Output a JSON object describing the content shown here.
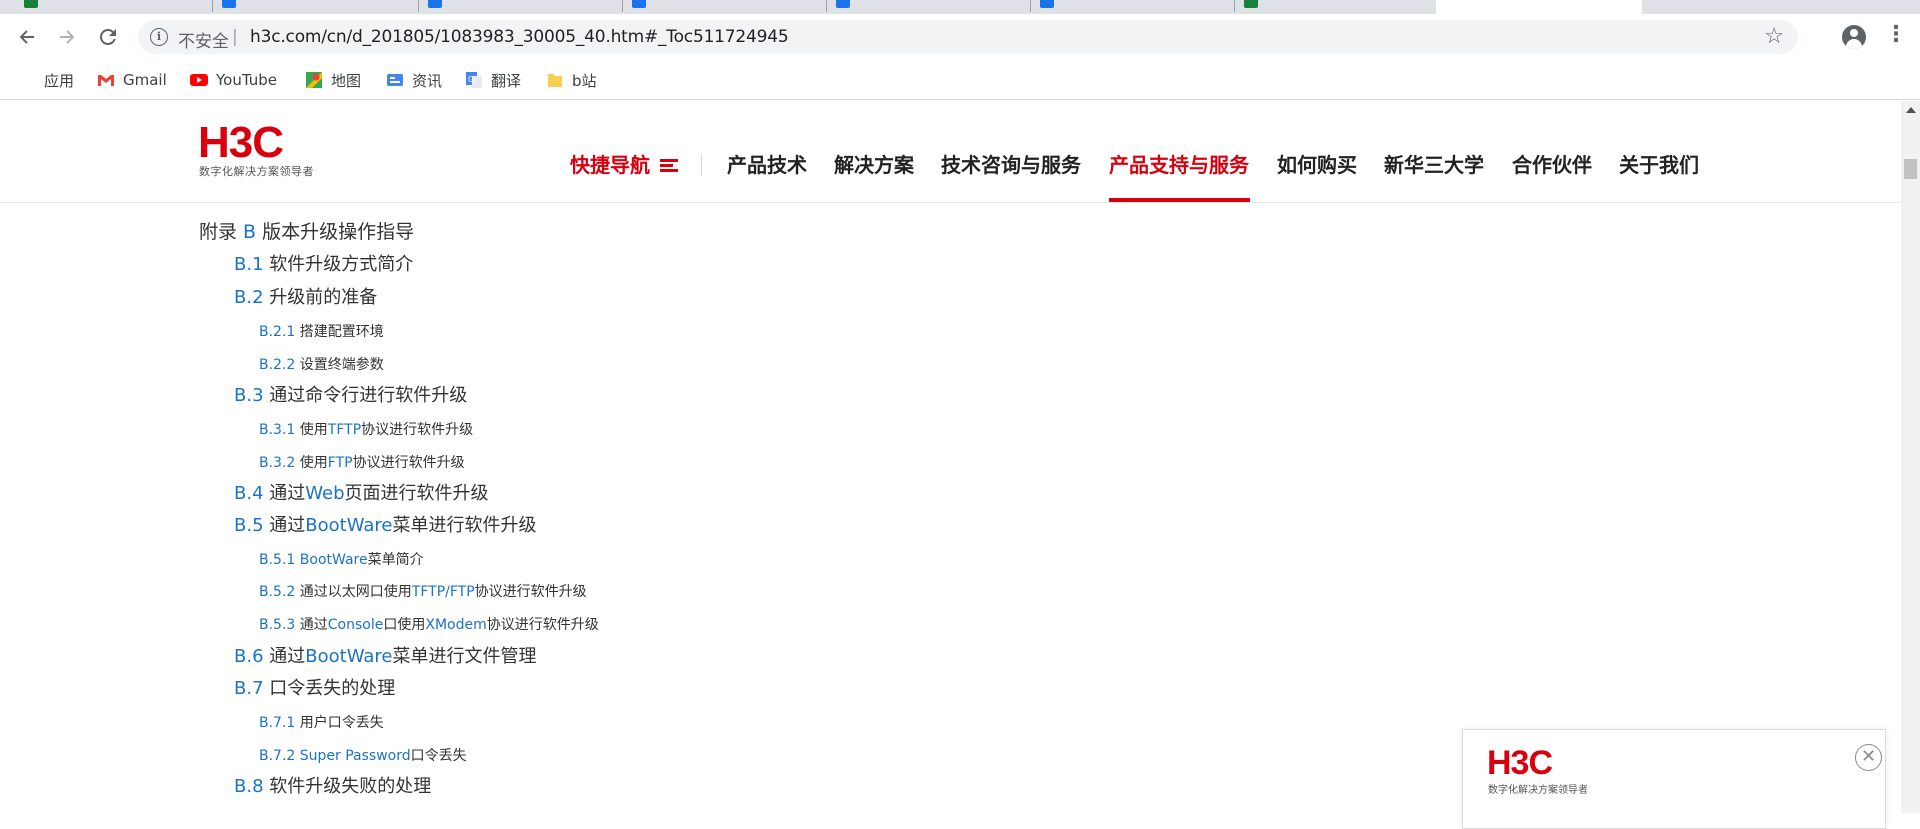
{
  "browser": {
    "tabs": [
      {
        "label": "...",
        "fav_color": "#188038"
      },
      {
        "label": "...",
        "fav_color": "#1a73e8"
      },
      {
        "label": "...",
        "fav_color": "#1a73e8"
      },
      {
        "label": "...",
        "fav_color": "#1a73e8"
      },
      {
        "label": "...",
        "fav_color": "#1a73e8"
      },
      {
        "label": "...",
        "fav_color": "#1a73e8"
      },
      {
        "label": "...",
        "fav_color": "#188038"
      }
    ],
    "omnibox": {
      "security_label": "不安全",
      "separator": "|",
      "url": "h3c.com/cn/d_201805/1083983_30005_40.htm#_Toc511724945"
    },
    "bookmarks": [
      {
        "label": "应用",
        "icon": "apps-grid-icon"
      },
      {
        "label": "Gmail",
        "icon": "gmail-icon"
      },
      {
        "label": "YouTube",
        "icon": "youtube-icon"
      },
      {
        "label": "地图",
        "icon": "maps-icon"
      },
      {
        "label": "资讯",
        "icon": "news-icon"
      },
      {
        "label": "翻译",
        "icon": "translate-icon"
      },
      {
        "label": "b站",
        "icon": "folder-icon"
      }
    ]
  },
  "site": {
    "logo_text": "H3C",
    "logo_tagline": "数字化解决方案领导者",
    "brand_color": "#d7000f",
    "nav": {
      "quick": "快捷导航",
      "items": [
        "产品技术",
        "解决方案",
        "技术咨询与服务",
        "产品支持与服务",
        "如何购买",
        "新华三大学",
        "合作伙伴",
        "关于我们"
      ],
      "active_index": 3
    }
  },
  "toc": [
    {
      "level": 1,
      "prefix": "附录 ",
      "num": "B",
      "title": " 版本升级操作指导"
    },
    {
      "level": 2,
      "num": "B.1",
      "title": " 软件升级方式简介"
    },
    {
      "level": 2,
      "num": "B.2",
      "title": " 升级前的准备"
    },
    {
      "level": 3,
      "num": "B.2.1",
      "title": " 搭建配置环境"
    },
    {
      "level": 3,
      "num": "B.2.2",
      "title": " 设置终端参数"
    },
    {
      "level": 2,
      "num": "B.3",
      "title": " 通过命令行进行软件升级"
    },
    {
      "level": 3,
      "num": "B.3.1",
      "title": " 使用",
      "en": "TFTP",
      "tail": "协议进行软件升级"
    },
    {
      "level": 3,
      "num": "B.3.2",
      "title": " 使用",
      "en": "FTP",
      "tail": "协议进行软件升级"
    },
    {
      "level": 2,
      "num": "B.4",
      "title": " 通过",
      "en": "Web",
      "tail": "页面进行软件升级"
    },
    {
      "level": 2,
      "num": "B.5",
      "title": " 通过",
      "en": "BootWare",
      "tail": "菜单进行软件升级"
    },
    {
      "level": 3,
      "num": "B.5.1",
      "title": " ",
      "en": "BootWare",
      "tail": "菜单简介"
    },
    {
      "level": 3,
      "num": "B.5.2",
      "title": " 通过以太网口使用",
      "en": "TFTP/FTP",
      "tail": "协议进行软件升级"
    },
    {
      "level": 3,
      "num": "B.5.3",
      "title": " 通过",
      "en": "Console",
      "tail": "口使用",
      "en2": "XModem",
      "tail2": "协议进行软件升级"
    },
    {
      "level": 2,
      "num": "B.6",
      "title": " 通过",
      "en": "BootWare",
      "tail": "菜单进行文件管理"
    },
    {
      "level": 2,
      "num": "B.7",
      "title": " 口令丢失的处理"
    },
    {
      "level": 3,
      "num": "B.7.1",
      "title": " 用户口令丢失"
    },
    {
      "level": 3,
      "num": "B.7.2",
      "title": " ",
      "en": "Super Password",
      "tail": "口令丢失"
    },
    {
      "level": 2,
      "num": "B.8",
      "title": " 软件升级失败的处理"
    }
  ],
  "float_card": {
    "logo_text": "H3C",
    "tagline": "数字化解决方案领导者",
    "close_glyph": "✕"
  }
}
